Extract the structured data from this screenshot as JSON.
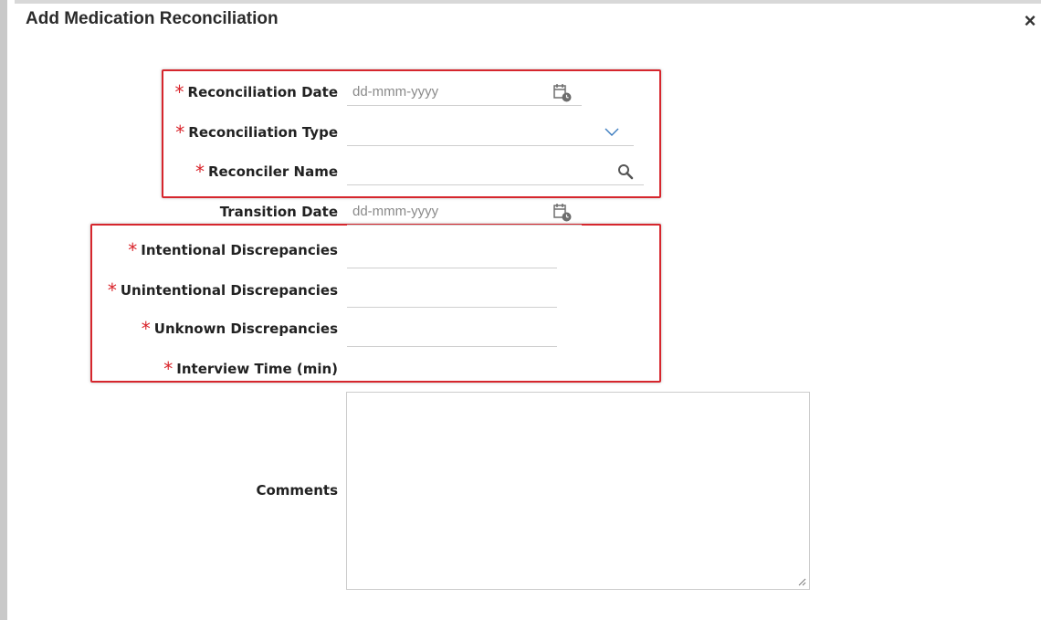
{
  "dialog": {
    "title": "Add Medication Reconciliation",
    "close_glyph": "×"
  },
  "required_marker": "*",
  "fields": {
    "reconciliation_date": {
      "label": "Reconciliation Date",
      "placeholder": "dd-mmm-yyyy",
      "required": true,
      "icon": "calendar-clock-icon"
    },
    "reconciliation_type": {
      "label": "Reconciliation Type",
      "value": "",
      "required": true,
      "icon": "chevron-down-icon"
    },
    "reconciler_name": {
      "label": "Reconciler Name",
      "value": "",
      "required": true,
      "icon": "search-icon"
    },
    "transition_date": {
      "label": "Transition Date",
      "placeholder": "dd-mmm-yyyy",
      "required": false,
      "icon": "calendar-clock-icon"
    },
    "intentional_discrepancies": {
      "label": "Intentional Discrepancies",
      "value": "",
      "required": true
    },
    "unintentional_discrepancies": {
      "label": "Unintentional Discrepancies",
      "value": "",
      "required": true
    },
    "unknown_discrepancies": {
      "label": "Unknown Discrepancies",
      "value": "",
      "required": true
    },
    "interview_time": {
      "label": "Interview Time (min)",
      "value": "",
      "required": true
    },
    "comments": {
      "label": "Comments",
      "value": ""
    }
  },
  "colors": {
    "required_star": "#d9232a",
    "highlight_box": "#d6262d",
    "chevron": "#3a7bbf",
    "field_underline": "#cfcfcf"
  }
}
